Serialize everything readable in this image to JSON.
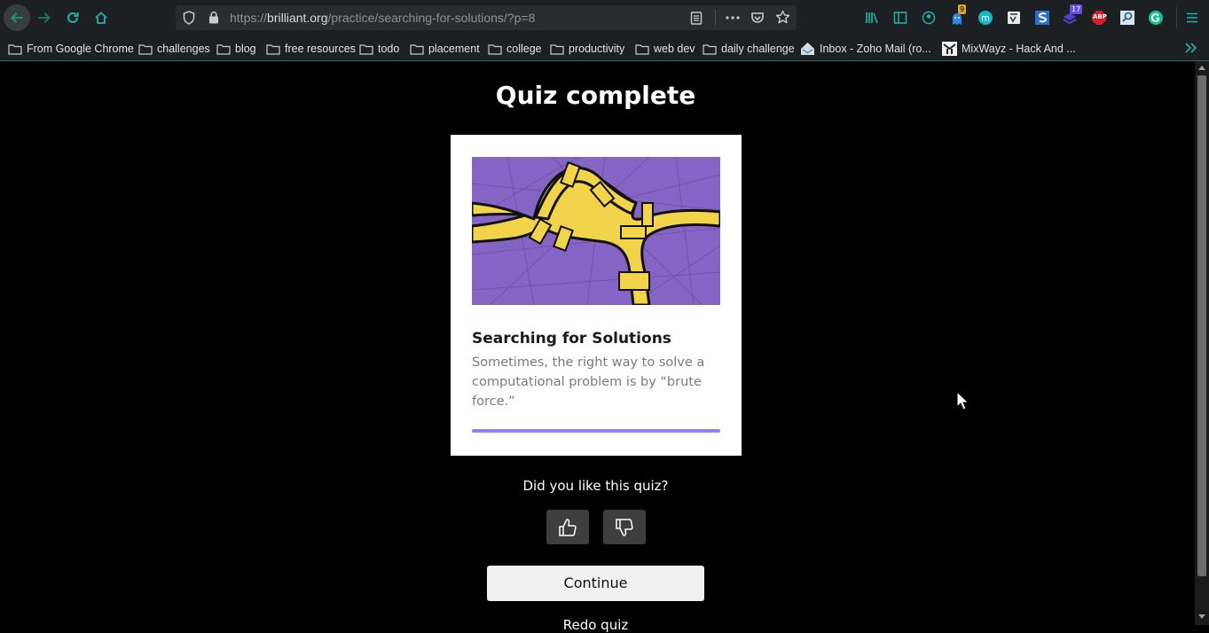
{
  "browser": {
    "url_prefix": "https://",
    "url_host": "brilliant.org",
    "url_path": "/practice/searching-for-solutions/?p=8",
    "badges": {
      "tab_count": "9",
      "ext_count": "17",
      "abp": "ABP"
    }
  },
  "bookmarks": [
    "From Google Chrome",
    "challenges",
    "blog",
    "free resources",
    "todo",
    "placement",
    "college",
    "productivity",
    "web dev",
    "daily challenge",
    "Inbox - Zoho Mail (ro...",
    "MixWayz - Hack And ..."
  ],
  "page": {
    "title": "Quiz complete",
    "card": {
      "title": "Searching for Solutions",
      "description": "Sometimes, the right way to solve a computational problem is by “brute force.”"
    },
    "feedback_question": "Did you like this quiz?",
    "continue_label": "Continue",
    "redo_label": "Redo quiz"
  },
  "colors": {
    "accent": "#9b7ef3",
    "chrome_bg": "#1d2023",
    "icon_teal": "#1fb4a8",
    "page_bg": "#000000"
  }
}
